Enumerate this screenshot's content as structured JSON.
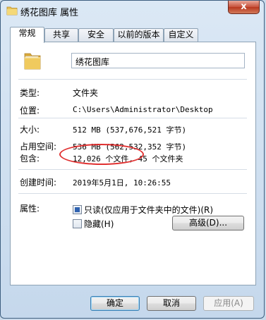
{
  "window": {
    "title": "绣花图库 属性",
    "close_label": "x"
  },
  "tabs": [
    {
      "label": "常规",
      "active": true
    },
    {
      "label": "共享",
      "active": false
    },
    {
      "label": "安全",
      "active": false
    },
    {
      "label": "以前的版本",
      "active": false
    },
    {
      "label": "自定义",
      "active": false
    }
  ],
  "general": {
    "folder_name": "绣花图库",
    "rows": {
      "type": {
        "label": "类型:",
        "value": "文件夹"
      },
      "location": {
        "label": "位置:",
        "value": "C:\\Users\\Administrator\\Desktop"
      },
      "size": {
        "label": "大小:",
        "value": "512 MB (537,676,521 字节)"
      },
      "size_on_disk": {
        "label": "占用空间:",
        "value": "536 MB (562,532,352 字节)"
      },
      "contains": {
        "label": "包含:",
        "value": "12,026 个文件, 45 个文件夹"
      },
      "created": {
        "label": "创建时间:",
        "value": "2019年5月1日, 10:26:55"
      }
    },
    "attributes": {
      "label": "属性:",
      "readonly": {
        "label": "只读(仅应用于文件夹中的文件)(R)",
        "state": "indeterminate"
      },
      "hidden": {
        "label": "隐藏(H)",
        "checked": false
      },
      "advanced_button": "高级(D)..."
    }
  },
  "footer": {
    "ok": "确定",
    "cancel": "取消",
    "apply": "应用(A)"
  },
  "colors": {
    "annotation": "#e03030",
    "accent": "#2f62b0"
  }
}
